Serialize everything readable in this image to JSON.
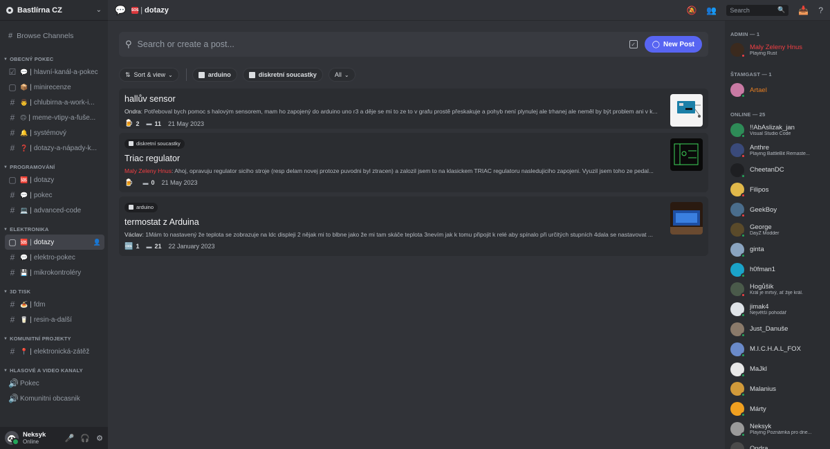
{
  "server": {
    "name": "Bastlírna CZ"
  },
  "sidebar": {
    "browse_label": "Browse Channels",
    "categories": [
      {
        "name": "OBECNÝ POKEC",
        "channels": [
          {
            "icon": "☑",
            "emoji": "💬",
            "name": "hlavní-kanál-a-pokec"
          },
          {
            "icon": "▢",
            "emoji": "📦",
            "name": "minirecenze"
          },
          {
            "icon": "#",
            "emoji": "👨",
            "name": "chlubirna-a-work-i..."
          },
          {
            "icon": "#",
            "emoji": "🙃",
            "name": "meme-vtipy-a-fuše..."
          },
          {
            "icon": "#",
            "emoji": "🔔",
            "name": "systémový"
          },
          {
            "icon": "#",
            "emoji": "❓",
            "name": "dotazy-a-nápady-k..."
          }
        ]
      },
      {
        "name": "PROGRAMOVÁNÍ",
        "channels": [
          {
            "icon": "▢",
            "emoji": "🆘",
            "name": "dotazy"
          },
          {
            "icon": "#",
            "emoji": "💬",
            "name": "pokec"
          },
          {
            "icon": "#",
            "emoji": "💻",
            "name": "advanced-code"
          }
        ]
      },
      {
        "name": "ELEKTRONIKA",
        "channels": [
          {
            "icon": "▢",
            "emoji": "🆘",
            "name": "dotazy",
            "active": true
          },
          {
            "icon": "#",
            "emoji": "💬",
            "name": "elektro-pokec"
          },
          {
            "icon": "#",
            "emoji": "💾",
            "name": "mikrokontroléry"
          }
        ]
      },
      {
        "name": "3D TISK",
        "channels": [
          {
            "icon": "#",
            "emoji": "🍝",
            "name": "fdm"
          },
          {
            "icon": "#",
            "emoji": "🥛",
            "name": "resin-a-další"
          }
        ]
      },
      {
        "name": "KOMUNITNÍ PROJEKTY",
        "channels": [
          {
            "icon": "#",
            "emoji": "📍",
            "name": "elektronická-zátěž"
          }
        ]
      },
      {
        "name": "HLASOVÉ A VIDEO KANALY",
        "channels": [
          {
            "icon": "🔊",
            "emoji": "",
            "name": "Pokec"
          },
          {
            "icon": "🔊",
            "emoji": "",
            "name": "Komunitni obcasnik"
          }
        ]
      }
    ]
  },
  "user_panel": {
    "name": "Neksyk",
    "status": "Online"
  },
  "topbar": {
    "emoji_label": "SOS",
    "channel": "dotazy",
    "search_placeholder": "Search"
  },
  "forum": {
    "search_placeholder": "Search or create a post...",
    "new_post_label": "New Post",
    "sort_label": "Sort & view",
    "tags": [
      "arduino",
      "diskretní soucastky"
    ],
    "all_label": "All",
    "posts": [
      {
        "title": "hallův sensor",
        "tag": "",
        "author": "Ondra",
        "author_color": "normal",
        "preview": "Potřeboval bych pomoc s halovým sensorem, mam ho zapojený do arduino uno r3 a děje se mi to ze to v grafu prostě přeskakuje a pohyb není plynulej ale trhanej ale neměl by být problem ani v k...",
        "reaction_emoji": "🍺",
        "reaction_count": "2",
        "message_count": "11",
        "date": "21 May 2023"
      },
      {
        "title": "Triac regulator",
        "tag": "diskretní soucastky",
        "author": "Maly Zeleny Hnus",
        "author_color": "red",
        "preview": "Ahoj, opravuju regulator siciho stroje (resp delam novej protoze puvodni byl ztracen) a zalozil jsem to na klasickem TRIAC regulatoru nasledujiciho zapojeni. Vyuzil jsem toho ze pedal...",
        "reaction_emoji": "🍺",
        "reaction_count": "",
        "message_count": "0",
        "date": "21 May 2023"
      },
      {
        "title": "termostat z Arduina",
        "tag": "arduino",
        "author": "Václav",
        "author_color": "normal",
        "preview": "1Mám to nastavený že teplota se zobrazuje na ldc displeji 2 nějak mi to blbne jako že mi tam skáče teplota 3nevím jak k tomu připojit k relé aby spínalo při určitých stupních 4dala se nastavovat ...",
        "reaction_emoji": "🆒",
        "reaction_count": "1",
        "message_count": "21",
        "date": "22 January 2023"
      }
    ]
  },
  "members": {
    "groups": [
      {
        "name": "ADMIN — 1",
        "members": [
          {
            "name": "Maly Zeleny Hnus",
            "status_text": "Playing Rust",
            "name_color": "#f23f43",
            "avatar_color": "#3b2a1e",
            "status": "dnd"
          }
        ]
      },
      {
        "name": "ŠTAMGAST — 1",
        "members": [
          {
            "name": "Artael",
            "status_text": "",
            "name_color": "#e67e22",
            "avatar_color": "#c97aa4",
            "status": "mobile"
          }
        ]
      },
      {
        "name": "ONLINE — 25",
        "members": [
          {
            "name": "!!AbAslizak_jan",
            "status_text": "Visual Studio Code",
            "name_color": "#dbdee1",
            "avatar_color": "#2e8b57",
            "status": "online"
          },
          {
            "name": "Anthre",
            "status_text": "Playing BattleBit Remaste...",
            "name_color": "#dbdee1",
            "avatar_color": "#3a4a7a",
            "status": "dnd"
          },
          {
            "name": "CheetanDC",
            "status_text": "",
            "name_color": "#dbdee1",
            "avatar_color": "#1e1f22",
            "status": "online"
          },
          {
            "name": "Filipos",
            "status_text": "",
            "name_color": "#dbdee1",
            "avatar_color": "#e0b84a",
            "status": "dnd"
          },
          {
            "name": "GeekBoy",
            "status_text": "",
            "name_color": "#dbdee1",
            "avatar_color": "#4a6d8c",
            "status": "dnd"
          },
          {
            "name": "George",
            "status_text": "DayZ Modder",
            "name_color": "#dbdee1",
            "avatar_color": "#5a4a2a",
            "status": "online"
          },
          {
            "name": "ginta",
            "status_text": "",
            "name_color": "#dbdee1",
            "avatar_color": "#8aa4c0",
            "status": "online"
          },
          {
            "name": "h0fman1",
            "status_text": "",
            "name_color": "#dbdee1",
            "avatar_color": "#1aa3c9",
            "status": "online"
          },
          {
            "name": "Hogůšik",
            "status_text": "Král je mrtvý, ať žije král.",
            "name_color": "#dbdee1",
            "avatar_color": "#4a5a4a",
            "status": "dnd"
          },
          {
            "name": "jimak4",
            "status_text": "Největší pohodář",
            "name_color": "#dbdee1",
            "avatar_color": "#dfe3e8",
            "status": "online"
          },
          {
            "name": "Just_Danuše",
            "status_text": "",
            "name_color": "#dbdee1",
            "avatar_color": "#8a7a6a",
            "status": "online"
          },
          {
            "name": "M.I.C.H.A.L_FOX",
            "status_text": "",
            "name_color": "#dbdee1",
            "avatar_color": "#6a8ac9",
            "status": "online"
          },
          {
            "name": "MaJkl",
            "status_text": "",
            "name_color": "#dbdee1",
            "avatar_color": "#e8e8e8",
            "status": "online"
          },
          {
            "name": "Malanius",
            "status_text": "",
            "name_color": "#dbdee1",
            "avatar_color": "#d19a3a",
            "status": "online"
          },
          {
            "name": "Márty",
            "status_text": "",
            "name_color": "#dbdee1",
            "avatar_color": "#f0a020",
            "status": "online"
          },
          {
            "name": "Neksyk",
            "status_text": "Playing Poznámka pro dne...",
            "name_color": "#dbdee1",
            "avatar_color": "#9a9a9a",
            "status": "online"
          },
          {
            "name": "Ondra",
            "status_text": "",
            "name_color": "#dbdee1",
            "avatar_color": "#4a4a4a",
            "status": "dnd"
          }
        ]
      }
    ]
  },
  "colors": {
    "accent": "#5865f2",
    "online": "#23a55a",
    "dnd": "#f23f43"
  }
}
